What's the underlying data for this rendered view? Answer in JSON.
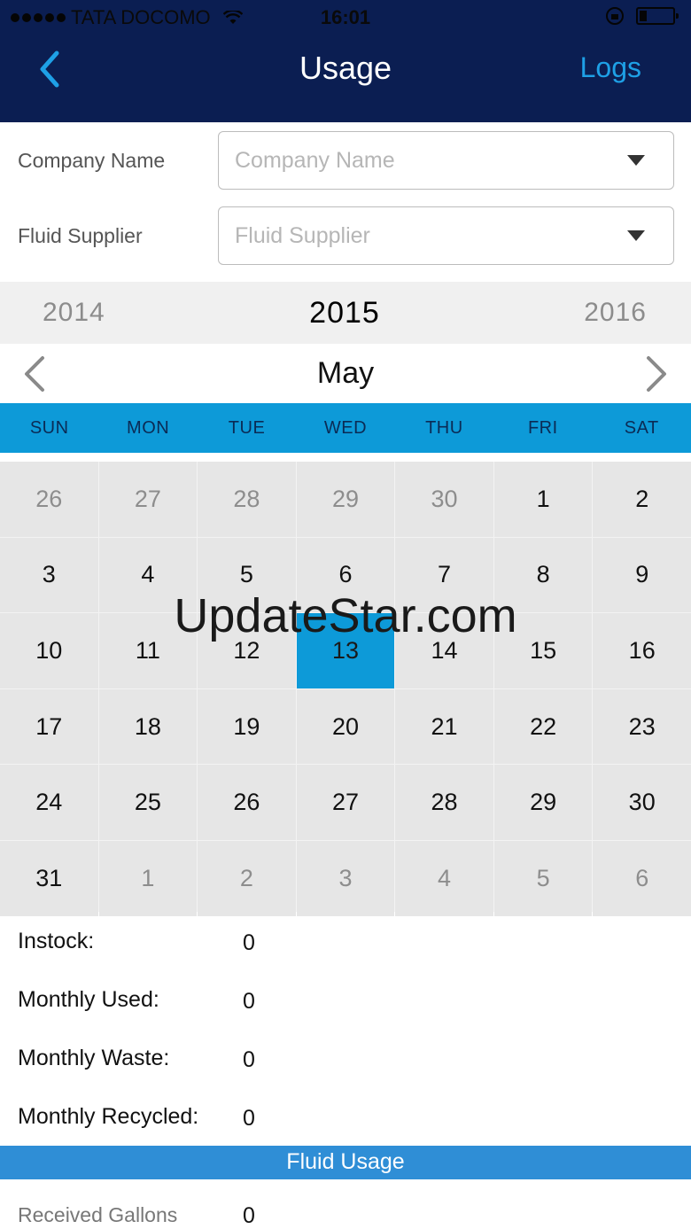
{
  "status_bar": {
    "carrier": "TATA DOCOMO",
    "time": "16:01"
  },
  "nav": {
    "title": "Usage",
    "right_action": "Logs",
    "bar_color": "#0b1e52",
    "accent": "#1ea0e6"
  },
  "form": {
    "company_label": "Company Name",
    "company_placeholder": "Company Name",
    "supplier_label": "Fluid Supplier",
    "supplier_placeholder": "Fluid Supplier"
  },
  "calendar": {
    "prev_year": "2014",
    "current_year": "2015",
    "next_year": "2016",
    "month": "May",
    "weekdays": [
      "SUN",
      "MON",
      "TUE",
      "WED",
      "THU",
      "FRI",
      "SAT"
    ],
    "days": [
      {
        "label": "26",
        "other": true
      },
      {
        "label": "27",
        "other": true
      },
      {
        "label": "28",
        "other": true
      },
      {
        "label": "29",
        "other": true
      },
      {
        "label": "30",
        "other": true
      },
      {
        "label": "1"
      },
      {
        "label": "2"
      },
      {
        "label": "3"
      },
      {
        "label": "4"
      },
      {
        "label": "5"
      },
      {
        "label": "6"
      },
      {
        "label": "7"
      },
      {
        "label": "8"
      },
      {
        "label": "9"
      },
      {
        "label": "10"
      },
      {
        "label": "11"
      },
      {
        "label": "12"
      },
      {
        "label": "13",
        "selected": true
      },
      {
        "label": "14"
      },
      {
        "label": "15"
      },
      {
        "label": "16"
      },
      {
        "label": "17"
      },
      {
        "label": "18"
      },
      {
        "label": "19"
      },
      {
        "label": "20"
      },
      {
        "label": "21"
      },
      {
        "label": "22"
      },
      {
        "label": "23"
      },
      {
        "label": "24"
      },
      {
        "label": "25"
      },
      {
        "label": "26"
      },
      {
        "label": "27"
      },
      {
        "label": "28"
      },
      {
        "label": "29"
      },
      {
        "label": "30"
      },
      {
        "label": "31"
      },
      {
        "label": "1",
        "other": true
      },
      {
        "label": "2",
        "other": true
      },
      {
        "label": "3",
        "other": true
      },
      {
        "label": "4",
        "other": true
      },
      {
        "label": "5",
        "other": true
      },
      {
        "label": "6",
        "other": true
      }
    ],
    "selected_color": "#0d9ad8"
  },
  "watermark": "UpdateStar.com",
  "stats": {
    "instock_label": "Instock:",
    "instock_value": "0",
    "monthly_used_label": "Monthly Used:",
    "monthly_used_value": "0",
    "monthly_waste_label": "Monthly Waste:",
    "monthly_waste_value": "0",
    "monthly_recycled_label": "Monthly Recycled:",
    "monthly_recycled_value": "0"
  },
  "fluid_usage": {
    "section_title": "Fluid Usage",
    "received_gallons_label": "Received Gallons",
    "received_gallons_value": "0"
  }
}
